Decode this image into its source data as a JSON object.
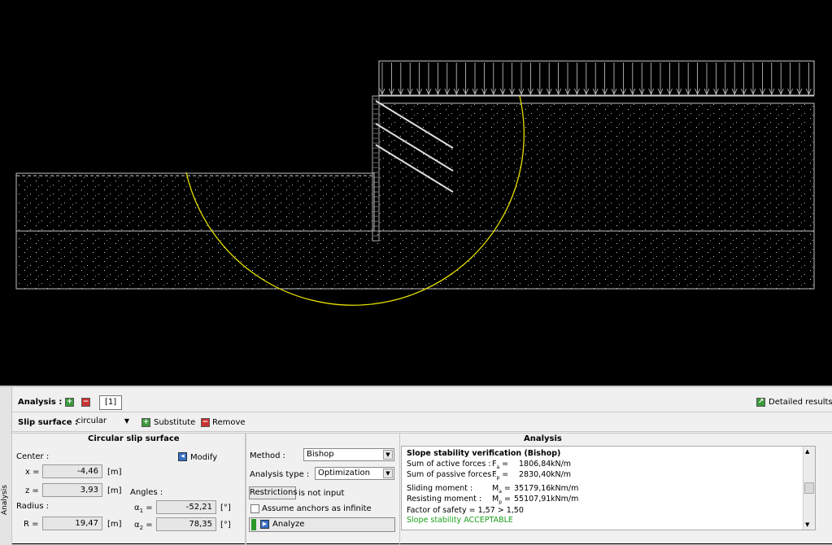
{
  "sidebar_tab": "Analysis",
  "toolbar": {
    "label": "Analysis :",
    "tab": "[1]",
    "detailed_results": "Detailed results"
  },
  "slip": {
    "label": "Slip surface :",
    "value": "circular",
    "substitute": "Substitute",
    "remove": "Remove"
  },
  "circular": {
    "title": "Circular slip surface",
    "center_label": "Center :",
    "modify": "Modify",
    "x_label": "x =",
    "x_value": "-4,46",
    "z_label": "z =",
    "z_value": "3,93",
    "unit_m": "[m]",
    "radius_label": "Radius :",
    "r_label": "R =",
    "r_value": "19,47",
    "angles_label": "Angles :",
    "a1_label": "α",
    "a1_sub": "1",
    "a1_value": "-52,21",
    "a2_label": "α",
    "a2_sub": "2",
    "a2_value": "78,35",
    "unit_deg": "[°]",
    "eq": "="
  },
  "method": {
    "method_label": "Method :",
    "method_value": "Bishop",
    "type_label": "Analysis type :",
    "type_value": "Optimization",
    "restrictions_button": "Restrictions",
    "restrictions_status": "is not input",
    "anchors_label": "Assume anchors as infinite",
    "analyze_button": "Analyze"
  },
  "analysis": {
    "title": "Analysis",
    "heading": "Slope stability verification (Bishop)",
    "active_label": "Sum of active forces :",
    "active_sym": "F",
    "active_sub": "a",
    "active_value": "1806,84",
    "active_unit": "kN/m",
    "passive_label": "Sum of passive forces :",
    "passive_sym": "F",
    "passive_sub": "p",
    "passive_value": "2830,40",
    "passive_unit": "kN/m",
    "sliding_label": "Sliding moment :",
    "sliding_sym": "M",
    "sliding_sub": "a",
    "sliding_value": "35179,16",
    "sliding_unit": "kNm/m",
    "resisting_label": "Resisting moment :",
    "resisting_sym": "M",
    "resisting_sub": "p",
    "resisting_value": "55107,91",
    "resisting_unit": "kNm/m",
    "fos": "Factor of safety = 1,57 > 1,50",
    "verdict": "Slope stability ACCEPTABLE",
    "verdict_color": "#1aa01a"
  },
  "colors": {
    "slip_circle": "#e8e000",
    "background": "#000000",
    "soil_outline": "#bfbfbf"
  }
}
